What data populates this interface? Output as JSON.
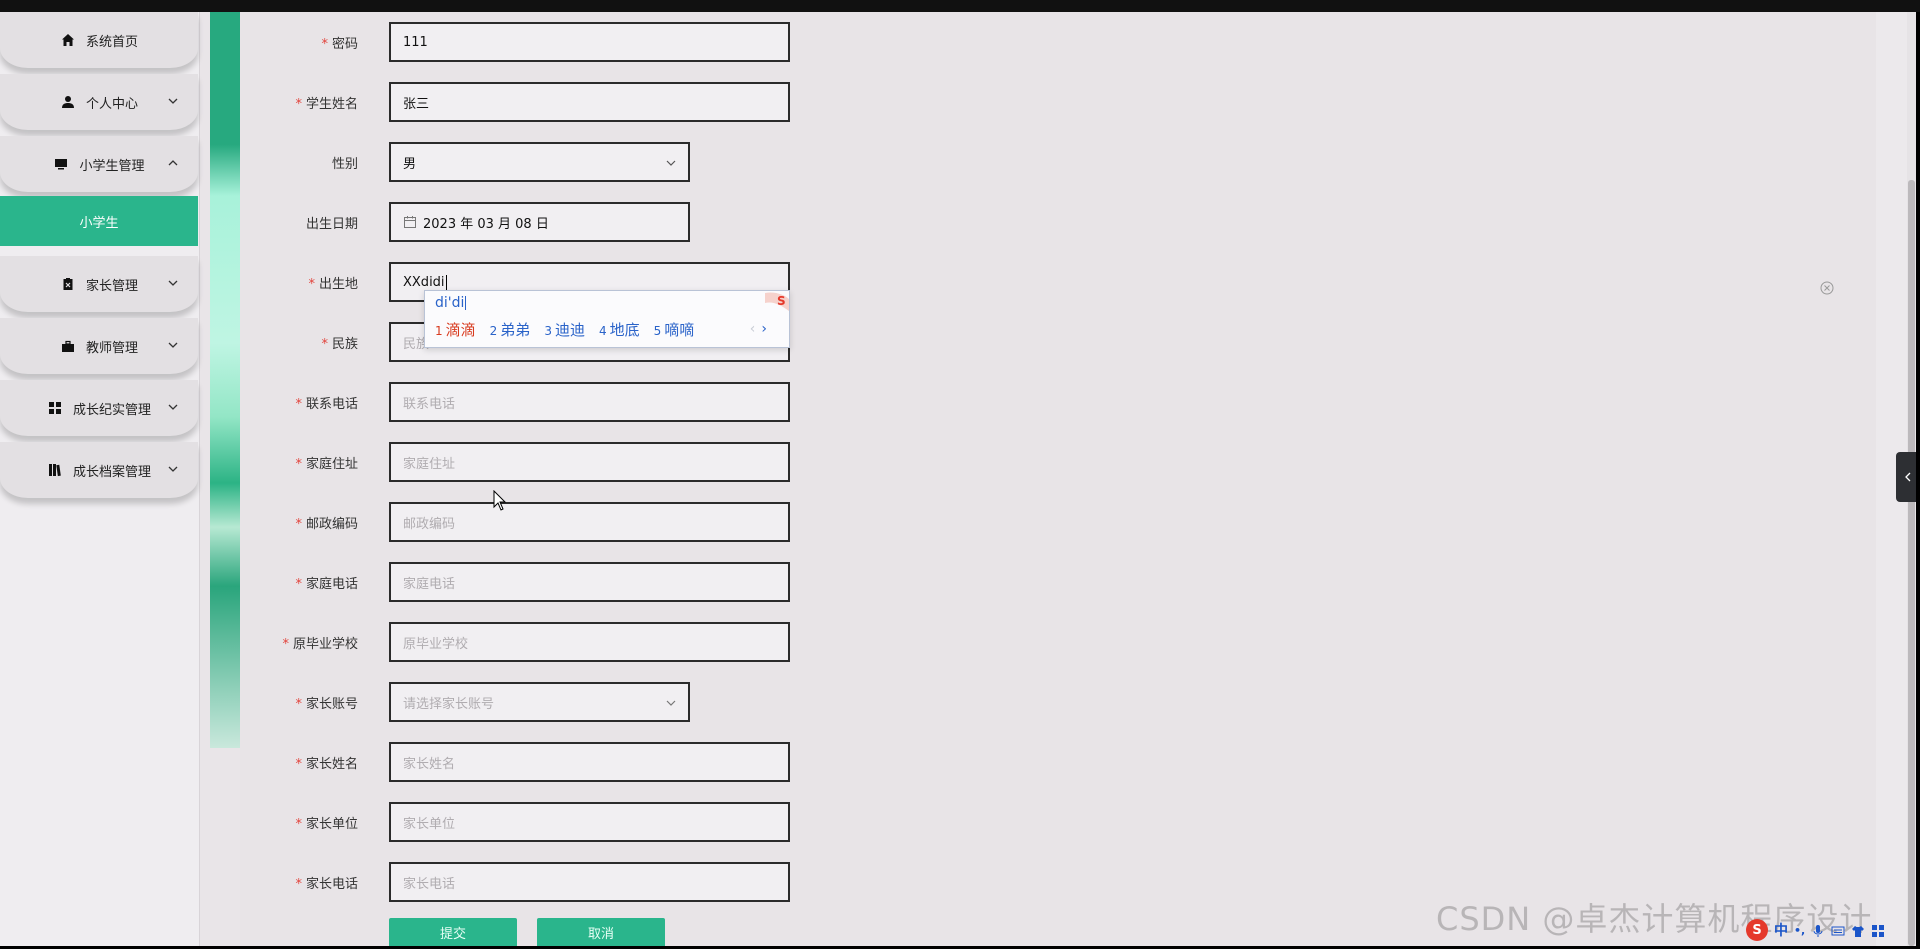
{
  "sidebar": {
    "items": [
      {
        "label": "系统首页",
        "icon": "home-icon"
      },
      {
        "label": "个人中心",
        "icon": "user-icon"
      },
      {
        "label": "小学生管理",
        "icon": "monitor-icon"
      },
      {
        "label": "家长管理",
        "icon": "clipboard-icon"
      },
      {
        "label": "教师管理",
        "icon": "briefcase-icon"
      },
      {
        "label": "成长纪实管理",
        "icon": "grid-icon"
      },
      {
        "label": "成长档案管理",
        "icon": "book-icon"
      }
    ],
    "active_sub": "小学生"
  },
  "form": {
    "password": {
      "label": "密码",
      "value": "111",
      "required": true
    },
    "student_name": {
      "label": "学生姓名",
      "value": "张三",
      "required": true
    },
    "gender": {
      "label": "性别",
      "value": "男"
    },
    "birth_date": {
      "label": "出生日期",
      "value": "2023 年 03 月 08 日"
    },
    "birthplace": {
      "label": "出生地",
      "value": "XXdidi",
      "required": true
    },
    "ethnicity": {
      "label": "民族",
      "placeholder": "民族",
      "required": true
    },
    "phone": {
      "label": "联系电话",
      "placeholder": "联系电话",
      "required": true
    },
    "address": {
      "label": "家庭住址",
      "placeholder": "家庭住址",
      "required": true
    },
    "postcode": {
      "label": "邮政编码",
      "placeholder": "邮政编码",
      "required": true
    },
    "home_phone": {
      "label": "家庭电话",
      "placeholder": "家庭电话",
      "required": true
    },
    "prev_school": {
      "label": "原毕业学校",
      "placeholder": "原毕业学校",
      "required": true
    },
    "parent_account": {
      "label": "家长账号",
      "placeholder": "请选择家长账号",
      "required": true
    },
    "parent_name": {
      "label": "家长姓名",
      "placeholder": "家长姓名",
      "required": true
    },
    "parent_work": {
      "label": "家长单位",
      "placeholder": "家长单位",
      "required": true
    },
    "parent_phone": {
      "label": "家长电话",
      "placeholder": "家长电话",
      "required": true
    },
    "submit_label": "提交",
    "cancel_label": "取消",
    "required_mark": "*"
  },
  "ime": {
    "pinyin": "di'di",
    "candidates": [
      {
        "num": "1",
        "text": "滴滴"
      },
      {
        "num": "2",
        "text": "弟弟"
      },
      {
        "num": "3",
        "text": "迪迪"
      },
      {
        "num": "4",
        "text": "地底"
      },
      {
        "num": "5",
        "text": "嘀嘀"
      }
    ],
    "prev": "‹",
    "next": "›"
  },
  "watermark": "CSDN @卓杰计算机程序设计",
  "tray": {
    "ime_mode": "中",
    "punct": "•,"
  },
  "colors": {
    "accent": "#2ab58c",
    "required": "#e2413a",
    "ime_blue": "#2a63c9",
    "ime_red": "#d83b1f"
  }
}
